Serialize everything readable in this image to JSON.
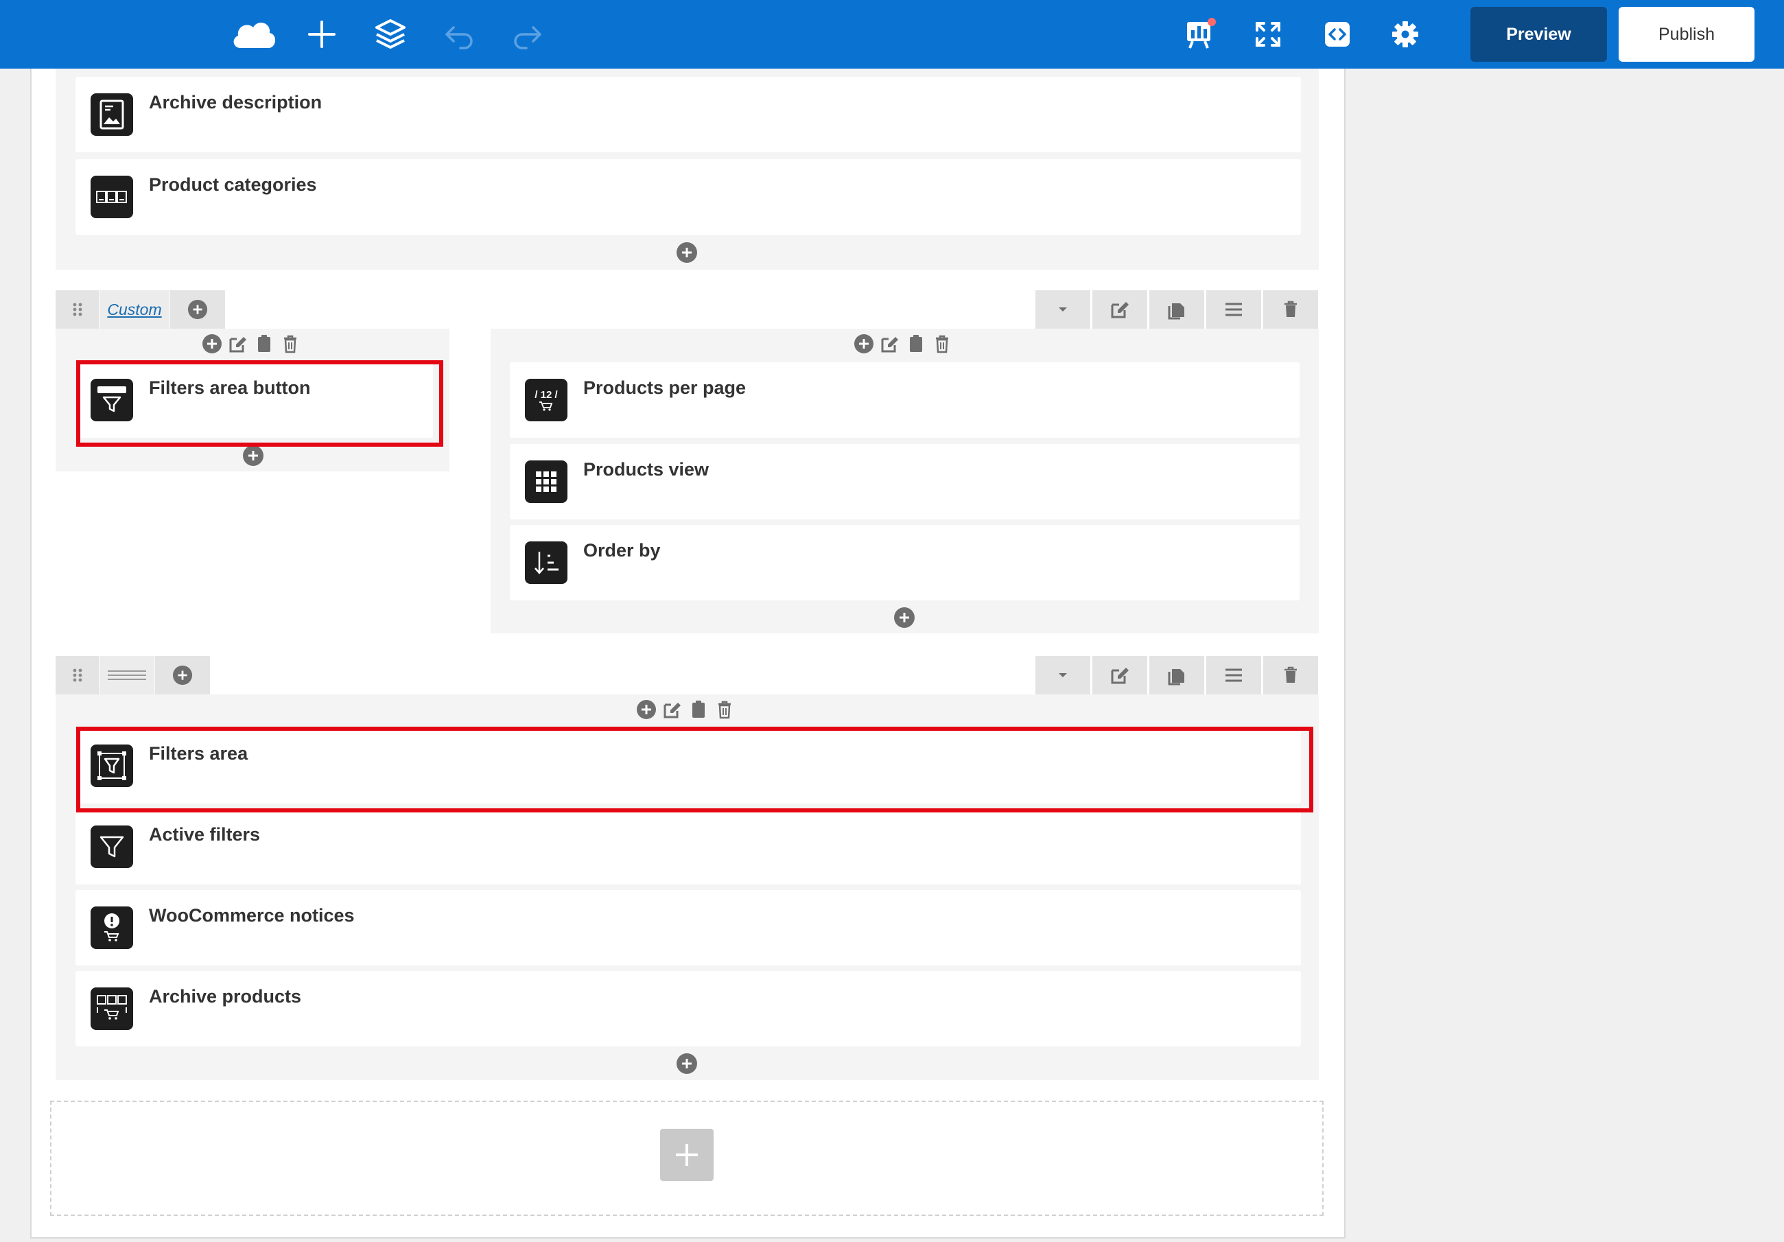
{
  "topbar": {
    "icons": [
      "cloud-icon",
      "plus-icon",
      "layers-icon",
      "undo-icon",
      "redo-icon",
      "chart-notify-icon",
      "fullscreen-icon",
      "code-icon",
      "gear-icon"
    ],
    "preview_label": "Preview",
    "publish_label": "Publish"
  },
  "section1": {
    "elements": [
      {
        "label": "Archive description",
        "icon": "archive-description-icon"
      },
      {
        "label": "Product categories",
        "icon": "product-categories-icon"
      }
    ]
  },
  "row1": {
    "layout_label": "Custom",
    "left_column": {
      "elements": [
        {
          "label": "Filters area button",
          "icon": "filter-button-icon",
          "highlighted": true
        }
      ]
    },
    "right_column": {
      "elements": [
        {
          "label": "Products per page",
          "icon": "products-per-page-icon",
          "icon_text": "/ 12 /"
        },
        {
          "label": "Products view",
          "icon": "grid-icon"
        },
        {
          "label": "Order by",
          "icon": "sort-icon"
        }
      ]
    }
  },
  "row2": {
    "layout_label": "",
    "elements": [
      {
        "label": "Filters area",
        "icon": "filters-area-icon",
        "highlighted": true
      },
      {
        "label": "Active filters",
        "icon": "funnel-icon"
      },
      {
        "label": "WooCommerce notices",
        "icon": "notice-cart-icon"
      },
      {
        "label": "Archive products",
        "icon": "archive-products-icon"
      }
    ]
  },
  "colors": {
    "topbar": "#0a73d2",
    "preview_bg": "#0c4a85",
    "highlight": "#e30613"
  }
}
